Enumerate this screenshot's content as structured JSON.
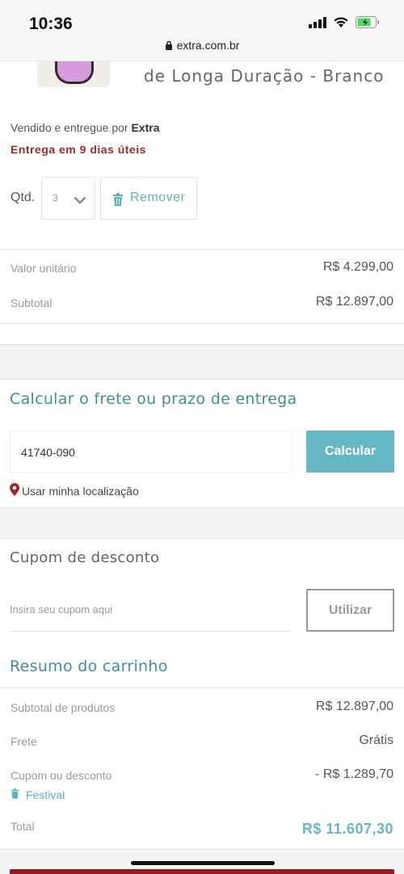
{
  "status": {
    "time": "10:36",
    "url": "extra.com.br"
  },
  "product": {
    "title_line": "de Longa Duração - Branco",
    "seller_prefix": "Vendido e entregue por",
    "seller_name": "Extra",
    "delivery": "Entrega em 9 dias úteis",
    "qty_label": "Qtd.",
    "qty_value": "3",
    "remove_label": "Remover",
    "unit_label": "Valor unitário",
    "unit_value": "R$ 4.299,00",
    "subtotal_label": "Subtotal",
    "subtotal_value": "R$ 12.897,00"
  },
  "shipping": {
    "title": "Calcular o frete ou prazo de entrega",
    "cep_value": "41740-090",
    "calc_label": "Calcular",
    "location_label": "Usar minha localização"
  },
  "coupon": {
    "title": "Cupom de desconto",
    "placeholder": "Insira seu cupom aqui",
    "use_label": "Utilizar"
  },
  "summary": {
    "title": "Resumo do carrinho",
    "products_label": "Subtotal de produtos",
    "products_value": "R$ 12.897,00",
    "shipping_label": "Frete",
    "shipping_value": "Grátis",
    "discount_label": "Cupom ou desconto",
    "discount_value": "- R$ 1.289,70",
    "coupon_name": "Festival",
    "total_label": "Total",
    "total_value": "R$ 11.607,30"
  },
  "colors": {
    "accent": "#66b7c3",
    "delivery": "#a02b2b",
    "brand": "#8e1e22"
  }
}
